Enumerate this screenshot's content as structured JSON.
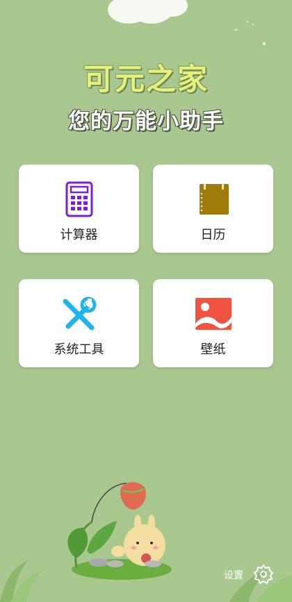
{
  "app": {
    "title": "可元之家",
    "subtitle": "您的万能小助手"
  },
  "cards": [
    {
      "label": "计算器",
      "icon": "calculator-icon",
      "color": "#7b1fd1"
    },
    {
      "label": "日历",
      "icon": "calendar-icon",
      "color": "#a07a0a"
    },
    {
      "label": "系统工具",
      "icon": "tools-icon",
      "color": "#1fb4ea"
    },
    {
      "label": "壁纸",
      "icon": "wallpaper-icon",
      "color": "#f0533f"
    }
  ],
  "settings": {
    "label": "设置",
    "icon": "gear-icon"
  },
  "colors": {
    "background": "#a9c88f",
    "title": "#e6f07a",
    "card": "#ffffff"
  }
}
